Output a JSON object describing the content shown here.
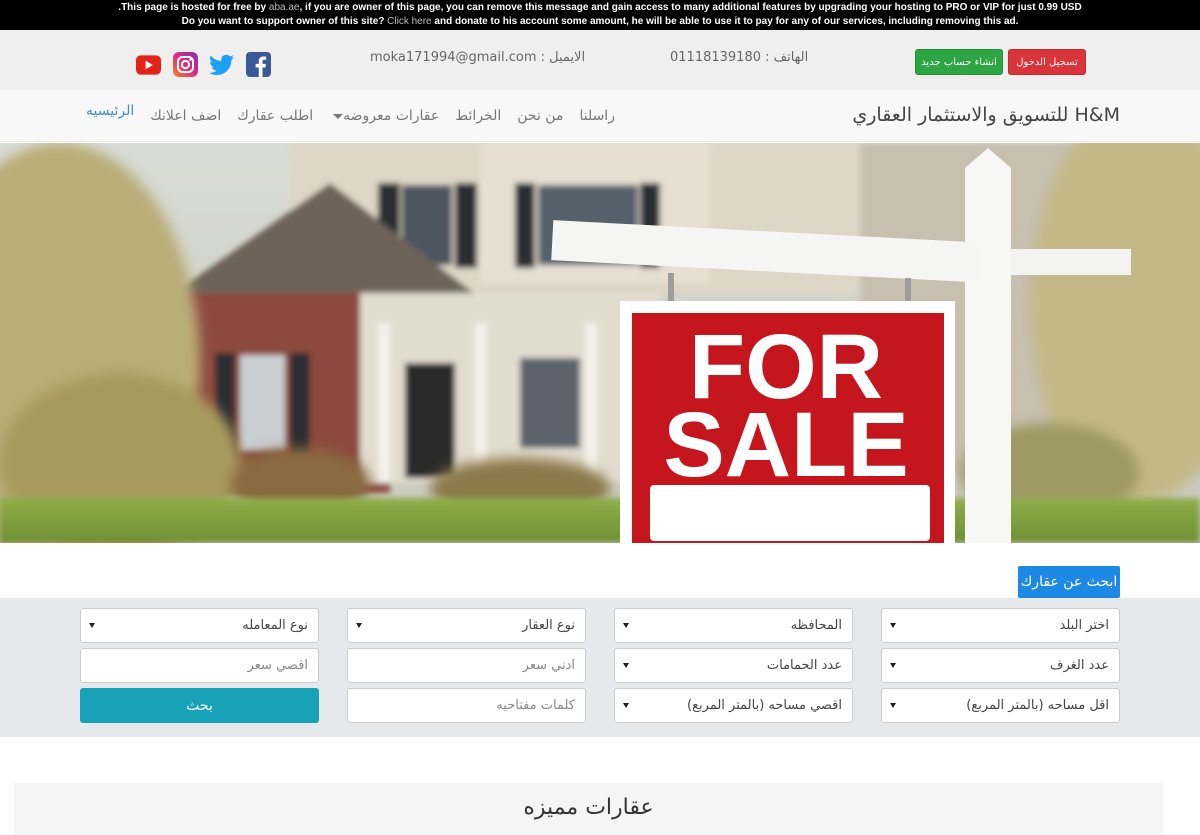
{
  "ad_bar": {
    "line1_prefix": ".This page is hosted for free by",
    "line1_link": "aba.ae",
    "line1_suffix": ", if you are owner of this page, you can remove this message and gain access to many additional features by upgrading your hosting to PRO or VIP for just 0.99 USD",
    "line2_prefix": "Do you want to support owner of this site?",
    "line2_link": "Click here",
    "line2_suffix": "and donate to his account some amount, he will be able to use it to pay for any of our services, including removing this ad."
  },
  "contact_bar": {
    "login_label": "تسجيل الدخول",
    "register_label": "انشاء حساب جديد",
    "phone": "الهاتف : 01118139180",
    "email": "الايميل : moka171994@gmail.com",
    "social": [
      "facebook-icon",
      "twitter-icon",
      "instagram-icon",
      "youtube-icon"
    ]
  },
  "nav": {
    "brand": "H&M للتسويق والاستثمار العقاري",
    "items": [
      "الرئيسيه",
      "اضف اعلانك",
      "اطلب عقارك",
      "عقارات معروضه",
      "الخرائط",
      "من نحن",
      "راسلنا"
    ]
  },
  "hero": {
    "sign_line1": "FOR",
    "sign_line2": "SALE"
  },
  "search": {
    "tab_label": "ابحث عن عقارك",
    "country": "اختر البلد",
    "governorate": "المحافظه",
    "property_type": "نوع العقار",
    "transaction_type": "نوع المعامله",
    "rooms": "عدد الغرف",
    "bathrooms": "عدد الحمامات",
    "min_price_placeholder": "ادني سعر",
    "max_price_placeholder": "اقصي سعر",
    "min_area": "اقل مساحه (بالمتر المربع)",
    "max_area": "اقصي مساحه (بالمتر المربع)",
    "keywords_placeholder": "كلمات مفتاحيه",
    "submit_label": "بحث"
  },
  "featured": {
    "title": "عقارات مميزه"
  },
  "colors": {
    "login_red": "#d9343a",
    "register_green": "#2ea543",
    "accent_blue": "#1e88e5",
    "search_button": "#17a2b8",
    "sign_red": "#c4161c"
  }
}
